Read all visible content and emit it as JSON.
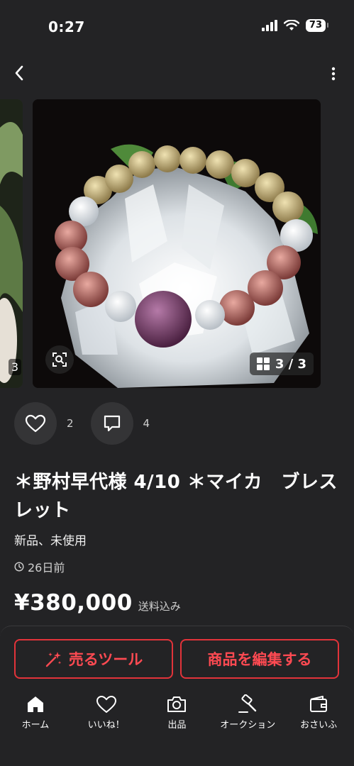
{
  "status_bar": {
    "time": "0:27",
    "battery": "73"
  },
  "gallery": {
    "counter": "3 / 3",
    "prev_counter": "3"
  },
  "actions": {
    "likes": "2",
    "comments": "4"
  },
  "item": {
    "title": "＊野村早代様 4/10 ＊マイカ　ブレスレット",
    "condition": "新品、未使用",
    "posted": "26日前",
    "price": "¥380,000",
    "shipping": "送料込み"
  },
  "buttons": {
    "sell_tool": "売るツール",
    "edit_item": "商品を編集する"
  },
  "tabbar": {
    "items": [
      {
        "label": "ホーム",
        "icon": "home-icon"
      },
      {
        "label": "いいね！",
        "icon": "heart-icon"
      },
      {
        "label": "出品",
        "icon": "camera-icon"
      },
      {
        "label": "オークション",
        "icon": "gavel-icon"
      },
      {
        "label": "おさいふ",
        "icon": "wallet-icon"
      }
    ]
  },
  "colors": {
    "background": "#232325",
    "accent": "#e2333a"
  }
}
